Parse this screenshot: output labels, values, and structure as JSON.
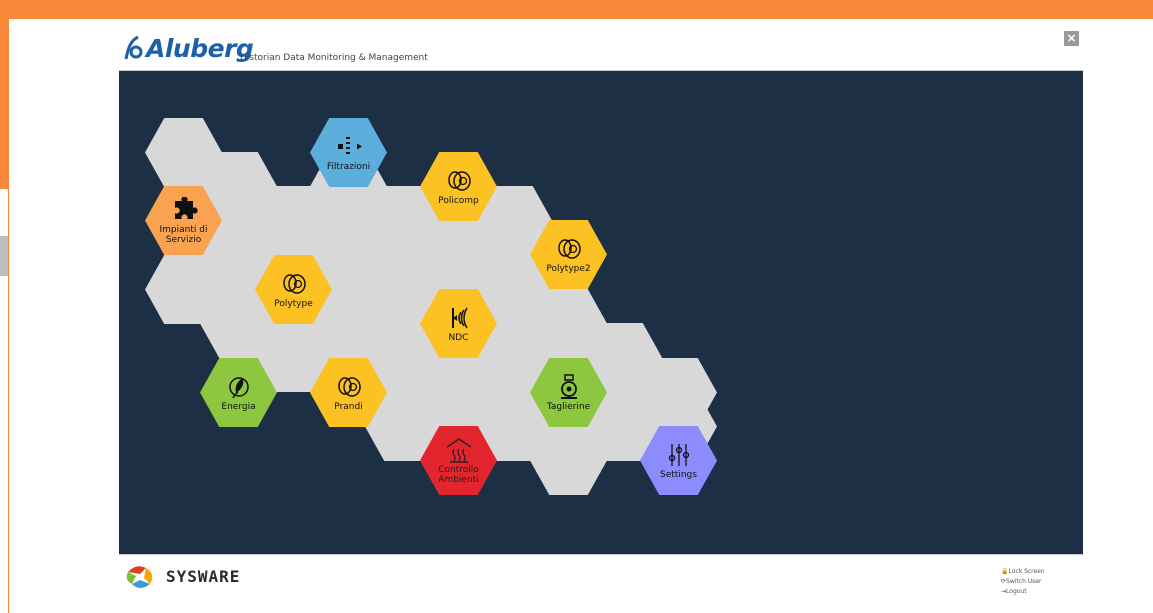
{
  "header": {
    "logo_text": "Aluberg",
    "subtitle": "Historian Data Monitoring & Management",
    "close_glyph": "×"
  },
  "tiles": [
    {
      "id": "impianti",
      "label": "Impianti di Servizio",
      "color": "#f9a350",
      "icon": "puzzle-icon"
    },
    {
      "id": "filtrazioni",
      "label": "Filtrazioni",
      "color": "#5caedc",
      "icon": "filter-icon"
    },
    {
      "id": "policomp",
      "label": "Policomp",
      "color": "#fcc123",
      "icon": "coil-icon"
    },
    {
      "id": "polytype2",
      "label": "Polytype2",
      "color": "#fcc123",
      "icon": "coil-icon"
    },
    {
      "id": "polytype",
      "label": "Polytype",
      "color": "#fcc123",
      "icon": "coil-icon"
    },
    {
      "id": "ndc",
      "label": "NDC",
      "color": "#fcc123",
      "icon": "ndc-icon"
    },
    {
      "id": "energia",
      "label": "Energia",
      "color": "#8dc63f",
      "icon": "leaf-icon"
    },
    {
      "id": "prandi",
      "label": "Prandi",
      "color": "#fcc123",
      "icon": "coil-icon"
    },
    {
      "id": "taglierine",
      "label": "Taglierine",
      "color": "#8dc63f",
      "icon": "slitter-icon"
    },
    {
      "id": "controllo",
      "label": "Controllo Ambienti",
      "color": "#e3262d",
      "icon": "heating-icon"
    },
    {
      "id": "settings",
      "label": "Settings",
      "color": "#8c8cff",
      "icon": "sliders-icon"
    }
  ],
  "footer": {
    "brand": "SYSWARE",
    "lock_screen": "Lock Screen",
    "switch_user": "Switch User",
    "logout": "Logout"
  }
}
